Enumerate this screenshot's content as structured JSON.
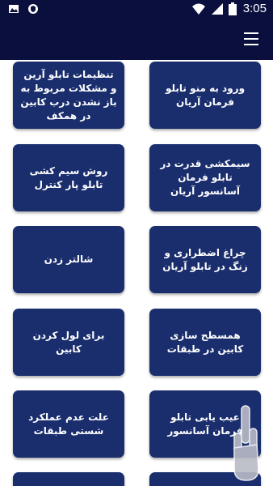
{
  "status_bar": {
    "time": "3:05",
    "left_icons": [
      "image-icon",
      "shield-icon"
    ],
    "right_icons": [
      "wifi-icon",
      "sim-icon",
      "battery-icon"
    ]
  },
  "app_bar": {
    "menu_icon": "hamburger-menu-icon"
  },
  "colors": {
    "app_bar": "#0b0f3d",
    "card": "#1a2e6e",
    "card_text": "#ffffff"
  },
  "grid": {
    "rows": [
      {
        "right": "ورود به منو تابلو فرمان آریان",
        "left": "تنظیمات تابلو آرین و مشکلات مربوط به باز نشدن درب کابین در همکف"
      },
      {
        "right": "سیمکشی قدرت در تابلو فرمان آسانسور آریان",
        "left": "روش سیم کشی تابلو پار کنترل"
      },
      {
        "right": "چراغ اضطراری و زنگ در تابلو آریان",
        "left": "شالتر زدن"
      },
      {
        "right": "همسطح سازی کابین در طبقات",
        "left": "برای لول کردن کابین"
      },
      {
        "right": "عیب یابی تابلو فرمان آسانسور",
        "left": "علت عدم عملکرد شستی طبقات"
      },
      {
        "right": "",
        "left": ""
      }
    ]
  }
}
